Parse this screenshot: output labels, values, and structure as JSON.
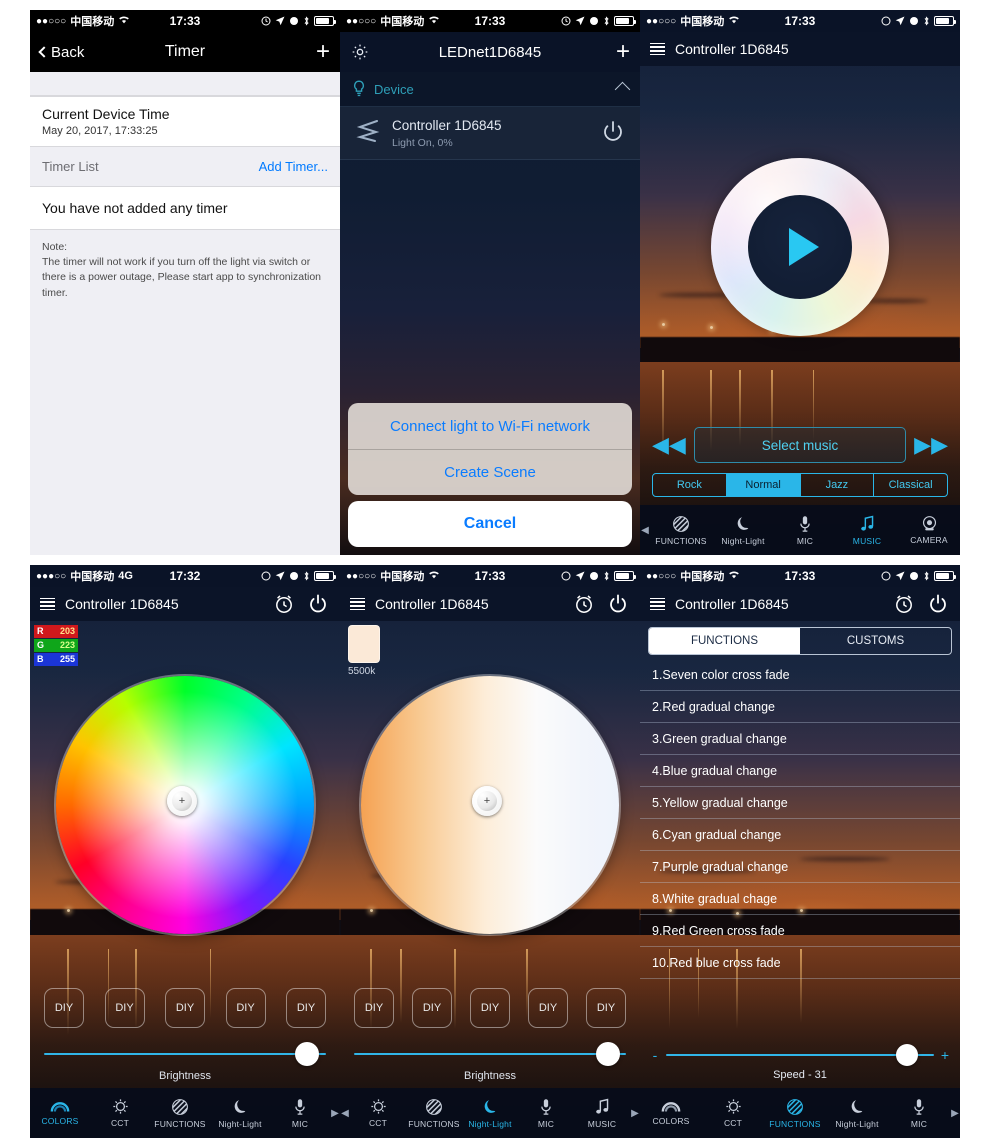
{
  "panel1": {
    "status": {
      "dots": "●●○○○",
      "carrier": "中国移动",
      "wifi": "wifi-icon",
      "time": "17:33"
    },
    "nav": {
      "back": "Back",
      "title": "Timer",
      "add": "+"
    },
    "device_time": {
      "title": "Current Device Time",
      "value": "May 20, 2017, 17:33:25"
    },
    "timer_list": {
      "label": "Timer List",
      "action": "Add Timer..."
    },
    "empty": "You have not added any timer",
    "note": {
      "head": "Note:",
      "body": "The timer will not work if you turn off the light via switch or there is a power outage, Please start app to synchronization timer."
    }
  },
  "panel2": {
    "status": {
      "dots": "●●○○○",
      "carrier": "中国移动",
      "time": "17:33"
    },
    "nav": {
      "title": "LEDnet1D6845",
      "add": "+"
    },
    "section": {
      "label": "Device"
    },
    "device": {
      "name": "Controller 1D6845",
      "state": "Light On, 0%"
    },
    "sheet": {
      "option1": "Connect light to Wi-Fi network",
      "option2": "Create Scene",
      "cancel": "Cancel"
    }
  },
  "panel3": {
    "status": {
      "dots": "●●○○○",
      "carrier": "中国移动",
      "time": "17:33"
    },
    "nav": {
      "title": "Controller 1D6845"
    },
    "music": {
      "select": "Select music",
      "prev": "◀◀",
      "next": "▶▶"
    },
    "modes": [
      "Rock",
      "Normal",
      "Jazz",
      "Classical"
    ],
    "active_mode": "Normal",
    "tabs": [
      {
        "label": "FUNCTIONS",
        "icon": "functions-icon",
        "active": false
      },
      {
        "label": "Night-Light",
        "icon": "moon-icon",
        "active": false
      },
      {
        "label": "MIC",
        "icon": "mic-icon",
        "active": false
      },
      {
        "label": "MUSIC",
        "icon": "music-note-icon",
        "active": true
      },
      {
        "label": "CAMERA",
        "icon": "camera-icon",
        "active": false
      }
    ]
  },
  "panel4": {
    "status": {
      "dots": "●●●○○",
      "carrier": "中国移动",
      "network": "4G",
      "time": "17:32"
    },
    "nav": {
      "title": "Controller 1D6845"
    },
    "rgb": {
      "r_label": "R",
      "r": "203",
      "g_label": "G",
      "g": "223",
      "b_label": "B",
      "b": "255"
    },
    "diy": [
      "DIY",
      "DIY",
      "DIY",
      "DIY",
      "DIY"
    ],
    "slider": {
      "label": "Brightness",
      "value": 97
    },
    "tabs": [
      {
        "label": "COLORS",
        "icon": "rainbow-icon",
        "active": true
      },
      {
        "label": "CCT",
        "icon": "sun-icon",
        "active": false
      },
      {
        "label": "FUNCTIONS",
        "icon": "functions-icon",
        "active": false
      },
      {
        "label": "Night-Light",
        "icon": "moon-icon",
        "active": false
      },
      {
        "label": "MIC",
        "icon": "mic-icon",
        "active": false
      }
    ]
  },
  "panel5": {
    "status": {
      "dots": "●●○○○",
      "carrier": "中国移动",
      "time": "17:33"
    },
    "nav": {
      "title": "Controller 1D6845"
    },
    "cct": {
      "kelvin": "5500k"
    },
    "diy": [
      "DIY",
      "DIY",
      "DIY",
      "DIY",
      "DIY"
    ],
    "slider": {
      "label": "Brightness",
      "value": 97
    },
    "tabs": [
      {
        "label": "CCT",
        "icon": "sun-icon",
        "active": false
      },
      {
        "label": "FUNCTIONS",
        "icon": "functions-icon",
        "active": false
      },
      {
        "label": "Night-Light",
        "icon": "moon-icon",
        "active": true
      },
      {
        "label": "MIC",
        "icon": "mic-icon",
        "active": false
      },
      {
        "label": "MUSIC",
        "icon": "music-note-icon",
        "active": false
      }
    ]
  },
  "panel6": {
    "status": {
      "dots": "●●○○○",
      "carrier": "中国移动",
      "time": "17:33"
    },
    "nav": {
      "title": "Controller 1D6845"
    },
    "segments": {
      "functions": "FUNCTIONS",
      "customs": "CUSTOMS",
      "active": "FUNCTIONS"
    },
    "functions": [
      "1.Seven color cross fade",
      "2.Red gradual change",
      "3.Green gradual change",
      "4.Blue gradual change",
      "5.Yellow gradual change",
      "6.Cyan gradual change",
      "7.Purple gradual change",
      "8.White gradual chage",
      "9.Red Green cross fade",
      "10.Red blue cross fade"
    ],
    "speed": {
      "minus": "-",
      "plus": "+",
      "label": "Speed - 31",
      "value": 89
    },
    "tabs": [
      {
        "label": "COLORS",
        "icon": "rainbow-icon",
        "active": false
      },
      {
        "label": "CCT",
        "icon": "sun-icon",
        "active": false
      },
      {
        "label": "FUNCTIONS",
        "icon": "functions-icon",
        "active": true
      },
      {
        "label": "Night-Light",
        "icon": "moon-icon",
        "active": false
      },
      {
        "label": "MIC",
        "icon": "mic-icon",
        "active": false
      }
    ]
  },
  "colors": {
    "accent": "#2ab6e8",
    "ios_blue": "#007aff",
    "teal": "#2e9fb8"
  }
}
